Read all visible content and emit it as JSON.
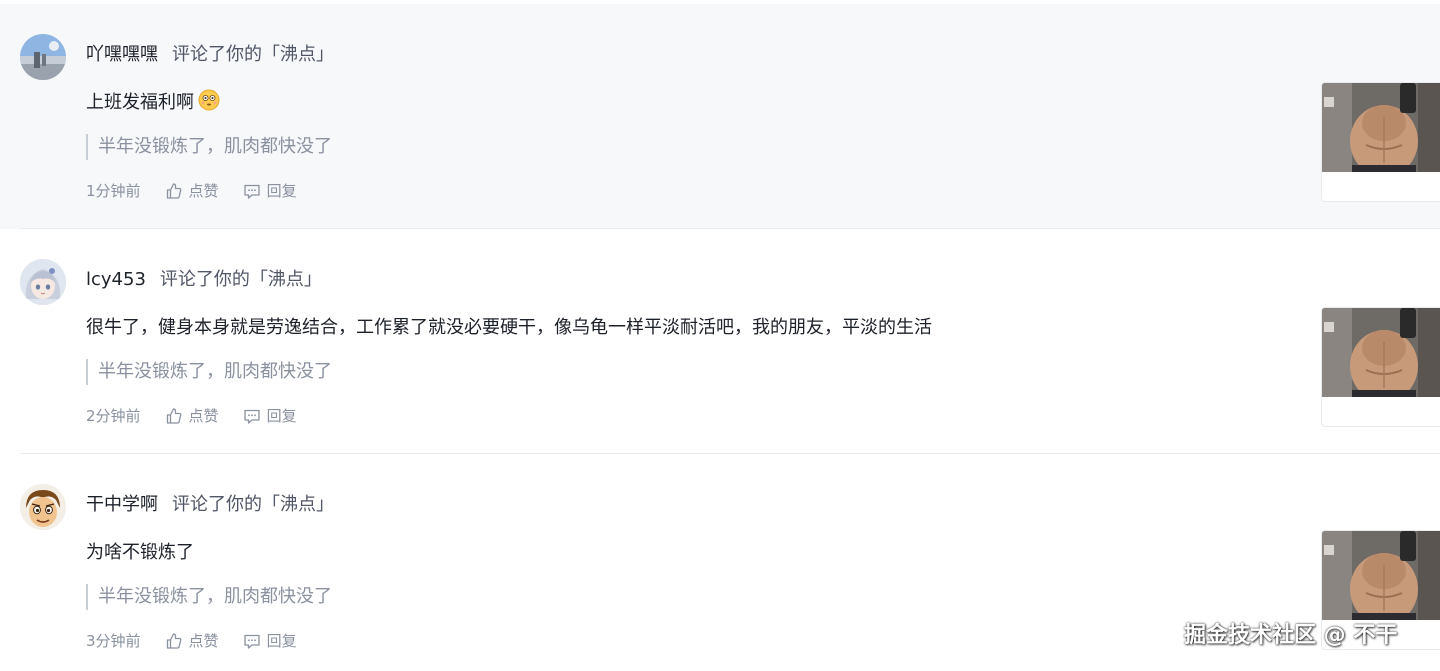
{
  "notifications": [
    {
      "username": "吖嘿嘿嘿",
      "action_text": "评论了你的「沸点」",
      "comment": "上班发福利啊",
      "emoji": "😳",
      "quoted": "半年没锻炼了，肌肉都快没了",
      "time": "1分钟前",
      "like_label": "点赞",
      "reply_label": "回复",
      "avatar": "landscape-avatar",
      "highlighted": true
    },
    {
      "username": "lcy453",
      "action_text": "评论了你的「沸点」",
      "comment": "很牛了，健身本身就是劳逸结合，工作累了就没必要硬干，像乌龟一样平淡耐活吧，我的朋友，平淡的生活",
      "quoted": "半年没锻炼了，肌肉都快没了",
      "time": "2分钟前",
      "like_label": "点赞",
      "reply_label": "回复",
      "avatar": "anime-girl-avatar",
      "highlighted": false
    },
    {
      "username": "干中学啊",
      "action_text": "评论了你的「沸点」",
      "comment": "为啥不锻炼了",
      "quoted": "半年没锻炼了，肌肉都快没了",
      "time": "3分钟前",
      "like_label": "点赞",
      "reply_label": "回复",
      "avatar": "cartoon-face-avatar",
      "highlighted": false
    }
  ],
  "watermark": "掘金技术社区 @ 不干",
  "colors": {
    "highlight_bg": "#f7f8fa",
    "text_primary": "#1d2129",
    "text_secondary": "#515767",
    "text_muted": "#8a919f",
    "divider": "#e8eaed"
  }
}
